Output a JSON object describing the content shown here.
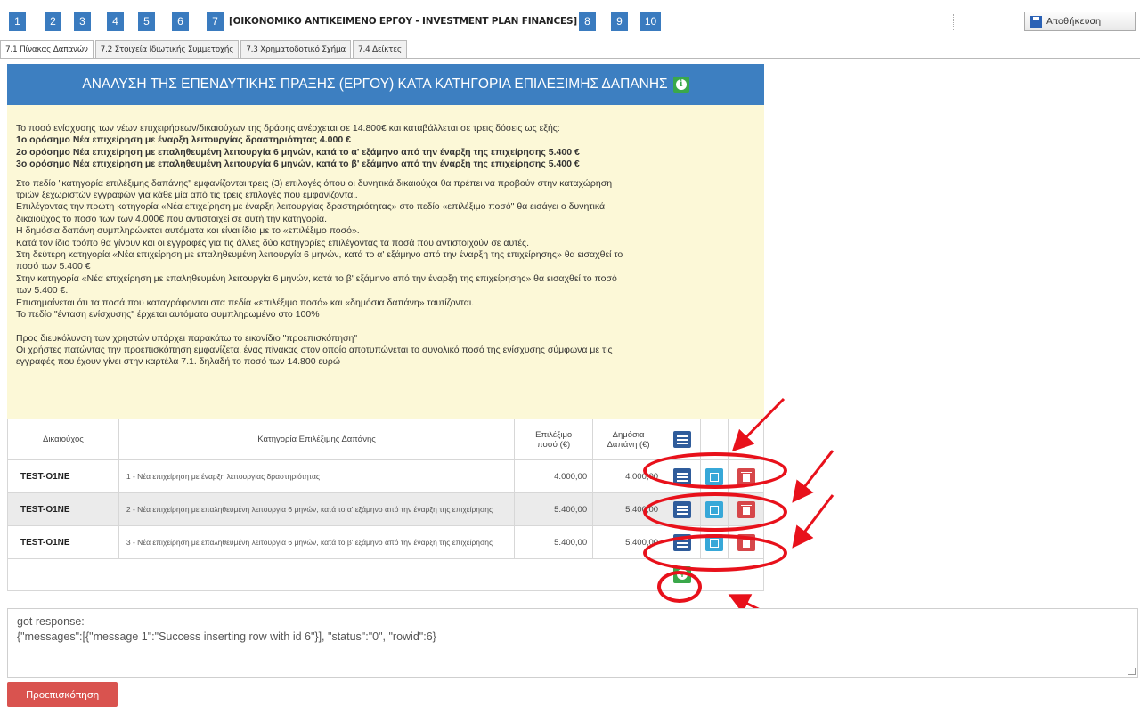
{
  "steps": [
    "1",
    "2",
    "3",
    "4",
    "5",
    "6",
    "7",
    "8",
    "9",
    "10"
  ],
  "step_title": "[ΟΙΚΟΝΟΜΙΚΟ ΑΝΤΙΚΕΙΜΕΝΟ ΕΡΓΟΥ - INVESTMENT PLAN FINANCES]",
  "save_label": "Αποθήκευση",
  "tabs": [
    "7.1 Πίνακας Δαπανών",
    "7.2 Στοιχεία Ιδιωτικής Συμμετοχής",
    "7.3 Χρηματοδοτικό Σχήμα",
    "7.4 Δείκτες"
  ],
  "banner_title": "ΑΝΑΛΥΣΗ ΤΗΣ ΕΠΕΝΔΥΤΙΚΗΣ ΠΡΑΞΗΣ (ΕΡΓΟΥ) ΚΑΤΑ ΚΑΤΗΓΟΡΙΑ ΕΠΙΛΕΞΙΜΗΣ ΔΑΠΑΝΗΣ",
  "note": {
    "intro": "Το ποσό ενίσχυσης των νέων επιχειρήσεων/δικαιούχων της δράσης ανέρχεται σε 14.800€ και καταβάλλεται σε τρεις δόσεις ως εξής:",
    "b1": "1ο ορόσημο Νέα επιχείρηση με έναρξη λειτουργίας δραστηριότητας 4.000 €",
    "b2": "2ο ορόσημο Νέα επιχείρηση με επαληθευμένη λειτουργία 6 μηνών, κατά το α' εξάμηνο από την έναρξη της επιχείρησης 5.400 €",
    "b3": "3ο ορόσημο Νέα επιχείρηση με επαληθευμένη λειτουργία 6 μηνών, κατά το β' εξάμηνο από την έναρξη της επιχείρησης 5.400 €",
    "l1": "Στο πεδίο \"κατηγορία επιλέξιμης δαπάνης\" εμφανίζονται τρεις (3) επιλογές όπου οι δυνητικά δικαιούχοι θα πρέπει να προβούν στην καταχώρηση",
    "l2": "τριών ξεχωριστών εγγραφών για κάθε μία από τις τρεις επιλογές που εμφανίζονται.",
    "l3": "Επιλέγοντας την πρώτη κατηγορία «Νέα επιχείρηση με έναρξη λειτουργίας δραστηριότητας» στο πεδίο «επιλέξιμο ποσό\" θα εισάγει ο δυνητικά",
    "l4": "δικαιούχος το ποσό των των 4.000€ που αντιστοιχεί σε αυτή την κατηγορία.",
    "l5": "Η δημόσια δαπάνη συμπληρώνεται αυτόματα και είναι ίδια με το «επιλέξιμο ποσό».",
    "l6": "Κατά τον ίδιο τρόπο θα γίνουν και οι εγγραφές για τις άλλες δύο κατηγορίες επιλέγοντας τα ποσά που αντιστοιχούν σε αυτές.",
    "l7": "Στη δεύτερη κατηγορία «Νέα επιχείρηση με επαληθευμένη λειτουργία 6 μηνών, κατά το α' εξάμηνο από την έναρξη της επιχείρησης» θα εισαχθεί το",
    "l8": "ποσό των 5.400 €",
    "l9": "Στην κατηγορία «Νέα επιχείρηση με επαληθευμένη λειτουργία 6 μηνών, κατά το β' εξάμηνο από την έναρξη της επιχείρησης» θα εισαχθεί το ποσό",
    "l10": "των 5.400 €.",
    "l11": "Επισημαίνεται ότι τα ποσά που καταγράφονται στα πεδία «επιλέξιμο ποσό» και «δημόσια δαπάνη» ταυτίζονται.",
    "l12": "Το πεδίο \"ένταση ενίσχυσης\" έρχεται αυτόματα συμπληρωμένο στο 100%",
    "l13": "Προς διευκόλυνση των χρηστών υπάρχει παρακάτω το εικονίδιο \"προεπισκόπηση\"",
    "l14": "Οι χρήστες πατώντας την προεπισκόπηση εμφανίζεται ένας πίνακας στον οποίο αποτυπώνεται το συνολικό ποσό της ενίσχυσης σύμφωνα με τις",
    "l15": "εγγραφές που έχουν γίνει στην καρτέλα 7.1. δηλαδή το ποσό των 14.800 ευρώ"
  },
  "table": {
    "headers": {
      "beneficiary": "Δικαιούχος",
      "category": "Κατηγορία Επιλέξιμης Δαπάνης",
      "eligible_1": "Επιλέξιμο",
      "eligible_2": "ποσό (€)",
      "public_1": "Δημόσια",
      "public_2": "Δαπάνη (€)"
    },
    "rows": [
      {
        "beneficiary": "TEST-O1NE",
        "category": "1 - Νέα επιχείρηση με έναρξη λειτουργίας δραστηριότητας",
        "eligible": "4.000,00",
        "public": "4.000,00"
      },
      {
        "beneficiary": "TEST-O1NE",
        "category": "2 - Νέα επιχείρηση με επαληθευμένη λειτουργία 6 μηνών, κατά το α' εξάμηνο από την έναρξη της επιχείρησης",
        "eligible": "5.400,00",
        "public": "5.400,00"
      },
      {
        "beneficiary": "TEST-O1NE",
        "category": "3 - Νέα επιχείρηση με επαληθευμένη λειτουργία 6 μηνών, κατά το β' εξάμηνο από την έναρξη της επιχείρησης",
        "eligible": "5.400,00",
        "public": "5.400,00"
      }
    ]
  },
  "response": {
    "line1": "got response:",
    "line2": "{\"messages\":[{\"message 1\":\"Success inserting row with id 6\"}], \"status\":\"0\", \"rowid\":6}"
  },
  "preview_label": "Προεπισκόπηση",
  "colors": {
    "step_blue": "#3a7bbf",
    "banner_blue": "#3d7fc1",
    "note_bg": "#fcf8d7",
    "annotation_red": "#e8111b",
    "add_green": "#3aa84a",
    "delete_red": "#d6474a"
  }
}
